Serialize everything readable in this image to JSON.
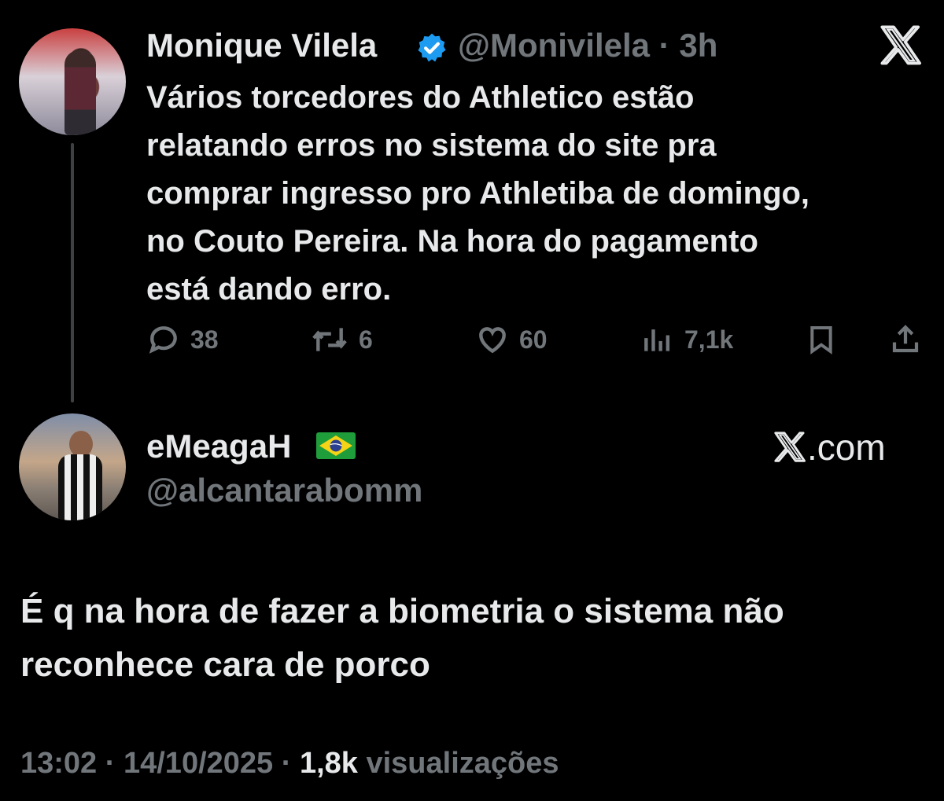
{
  "quoted_tweet": {
    "author_name": "Monique Vilela",
    "verified": true,
    "handle": "@Monivilela",
    "separator": " · ",
    "time_ago": "3h",
    "text": "Vários torcedores do Athletico estão\nrelatando erros no sistema do site pra\ncomprar ingresso pro Athletiba de domingo,\nno Couto Pereira. Na hora do pagamento\nestá dando erro.",
    "replies": "38",
    "reposts": "6",
    "likes": "60",
    "views": "7,1k"
  },
  "reply_tweet": {
    "author_name": "eMeagaH",
    "flag_icon": "brazil-flag-icon",
    "handle": "@alcantarabomm",
    "brand": "X.com",
    "text": "É q na hora de fazer a biometria o sistema não\nreconhece cara de porco",
    "time": "13:02",
    "date": "14/10/2025",
    "separator": " · ",
    "views_count": "1,8k",
    "views_label": "visualizações"
  },
  "colors": {
    "background": "#000000",
    "text": "#e7e9ea",
    "muted": "#71767b",
    "verified": "#1d9bf0"
  }
}
